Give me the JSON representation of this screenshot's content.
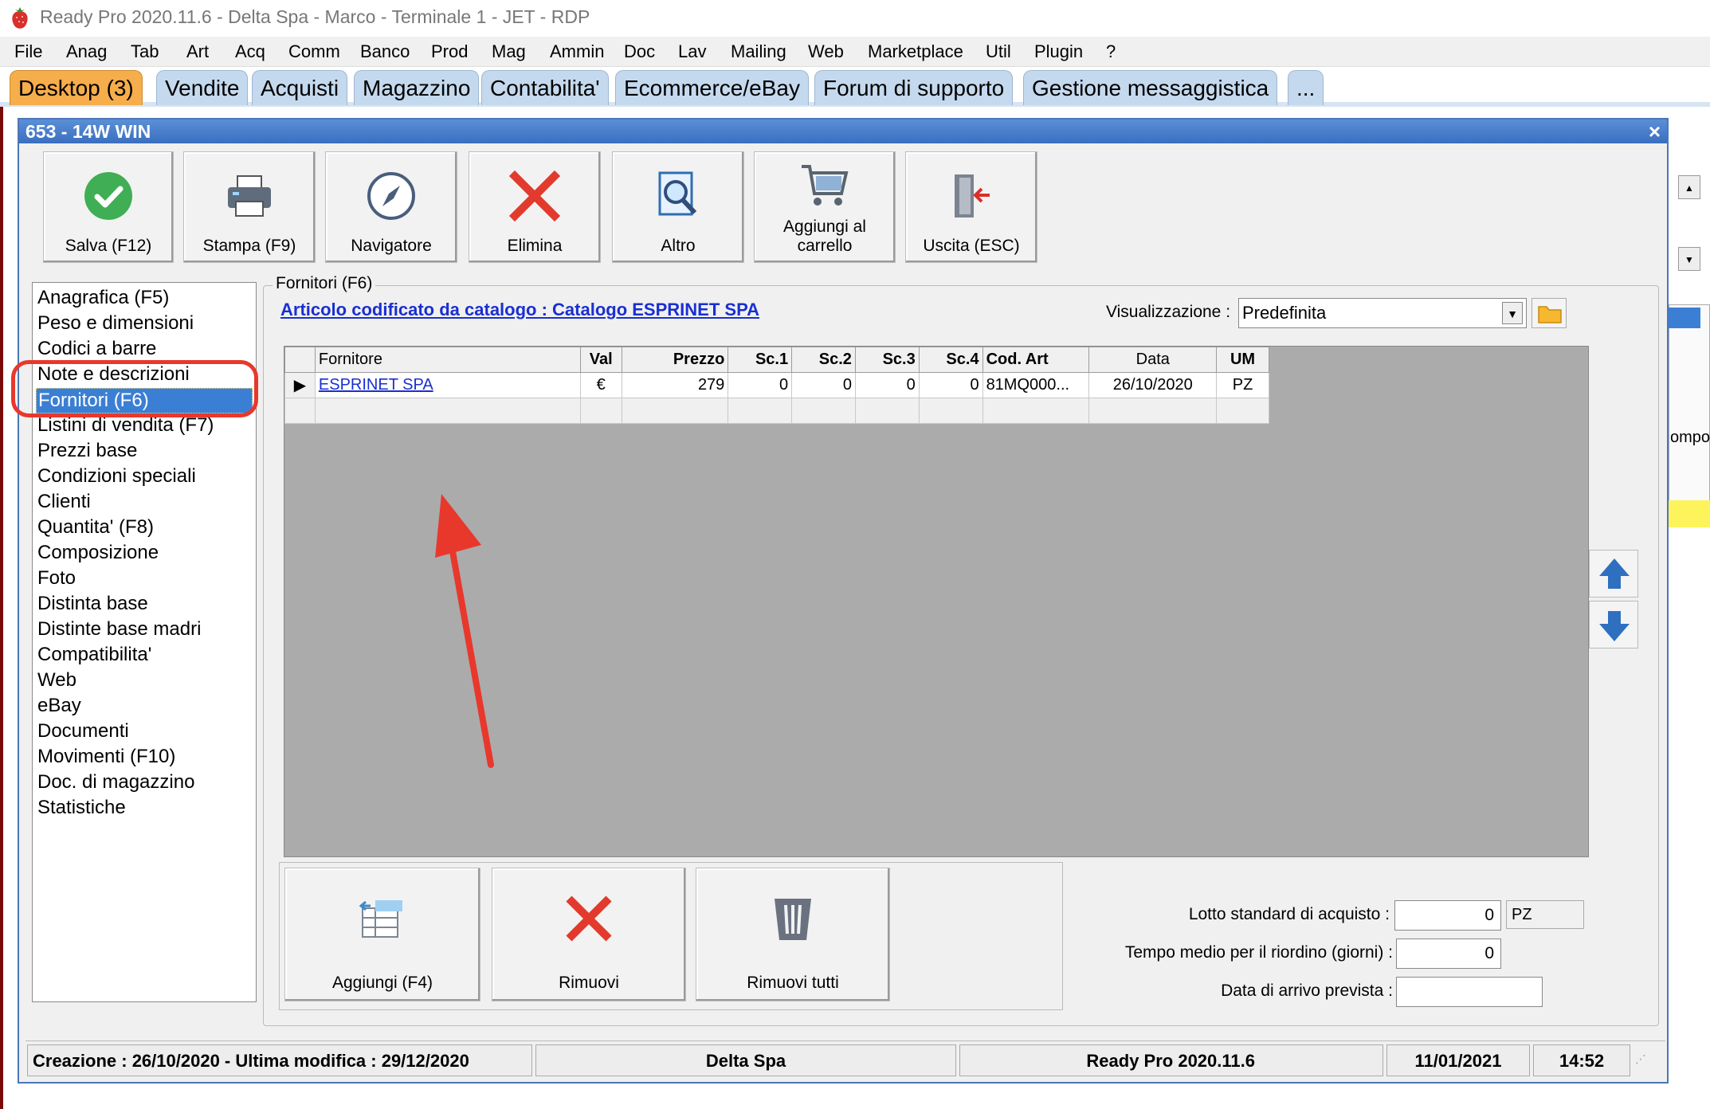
{
  "window_title": "Ready Pro 2020.11.6 - Delta Spa - Marco - Terminale 1 - JET - RDP",
  "menu": [
    "File",
    "Anag",
    "Tab",
    "Art",
    "Acq",
    "Comm",
    "Banco",
    "Prod",
    "Mag",
    "Ammin",
    "Doc",
    "Lav",
    "Mailing",
    "Web",
    "Marketplace",
    "Util",
    "Plugin",
    "?"
  ],
  "tabs": [
    "Desktop (3)",
    "Vendite",
    "Acquisti",
    "Magazzino",
    "Contabilita'",
    "Ecommerce/eBay",
    "Forum di supporto",
    "Gestione messaggistica",
    "..."
  ],
  "active_tab": "Desktop (3)",
  "dialog": {
    "caption": "653 - 14W WIN",
    "close": "×"
  },
  "toolbar": {
    "save": "Salva (F12)",
    "print": "Stampa (F9)",
    "navigator": "Navigatore",
    "delete": "Elimina",
    "other": "Altro",
    "cart_line1": "Aggiungi al",
    "cart_line2": "carrello",
    "exit": "Uscita (ESC)"
  },
  "nav": {
    "items": [
      "Anagrafica (F5)",
      "Peso e dimensioni",
      "Codici a barre",
      "Note e descrizioni",
      "Fornitori (F6)",
      "Listini di vendita (F7)",
      "Prezzi base",
      "Condizioni speciali",
      "Clienti",
      "Quantita' (F8)",
      "Composizione",
      "Foto",
      "Distinta base",
      "Distinte base madri",
      "Compatibilita'",
      "Web",
      "eBay",
      "Documenti",
      "Movimenti (F10)",
      "Doc. di magazzino",
      "Statistiche"
    ],
    "selected": "Fornitori (F6)"
  },
  "panel": {
    "group_title": "Fornitori (F6)",
    "catalog_link": "Articolo codificato da catalogo : Catalogo ESPRINET SPA",
    "view_label": "Visualizzazione :",
    "view_value": "Predefinita"
  },
  "grid": {
    "columns": [
      "Fornitore",
      "Val",
      "Prezzo",
      "Sc.1",
      "Sc.2",
      "Sc.3",
      "Sc.4",
      "Cod. Art",
      "Data",
      "UM"
    ],
    "rows": [
      [
        "ESPRINET SPA",
        "€",
        "279",
        "0",
        "0",
        "0",
        "0",
        "81MQ000...",
        "26/10/2020",
        "PZ"
      ]
    ]
  },
  "bottom_buttons": {
    "add": "Aggiungi (F4)",
    "remove": "Rimuovi",
    "remove_all": "Rimuovi tutti"
  },
  "form": {
    "lot_label": "Lotto standard di acquisto :",
    "lot_value": "0",
    "lot_unit": "PZ",
    "reorder_label": "Tempo medio per il riordino (giorni) :",
    "reorder_value": "0",
    "arrival_label": "Data di arrivo prevista :",
    "arrival_value": ""
  },
  "status": {
    "dates": "Creazione : 26/10/2020 - Ultima modifica : 29/12/2020",
    "company": "Delta Spa",
    "version": "Ready Pro 2020.11.6",
    "date": "11/01/2021",
    "time": "14:52"
  },
  "side_clip_text": "ompo",
  "colors": {
    "active_tab": "#f6ad4b",
    "tab": "#c5d9ee",
    "selection": "#3b7fd4",
    "link": "#1a2fd1",
    "annotation": "#e8382c"
  }
}
